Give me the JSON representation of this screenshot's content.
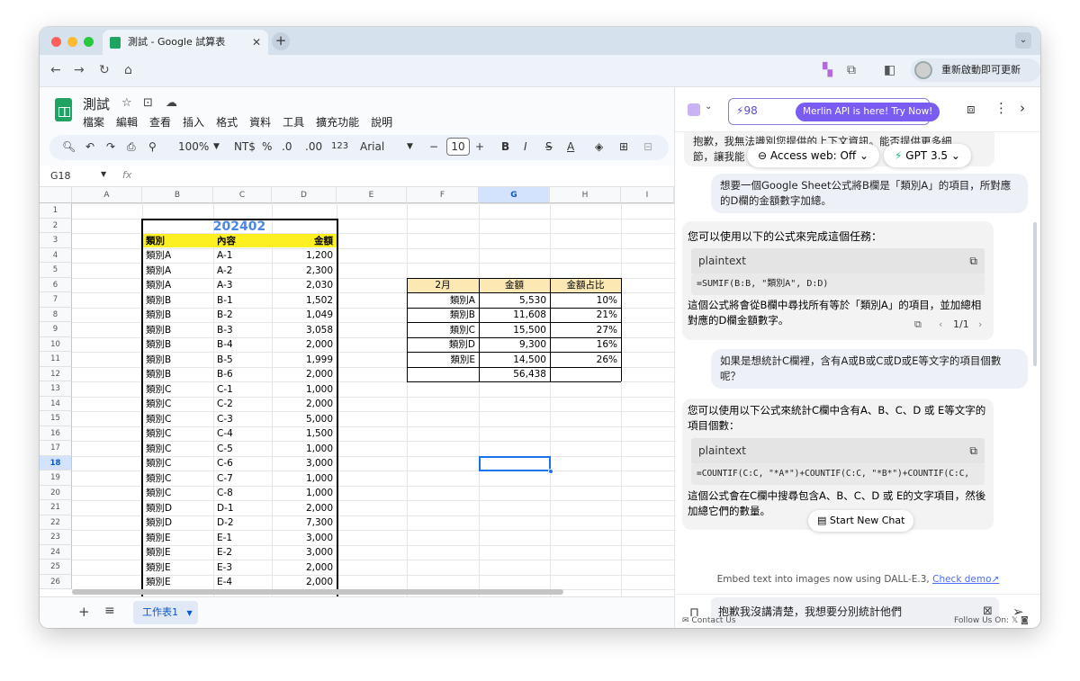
{
  "browser": {
    "tab_title": "測試 - Google 試算表",
    "update_label": "重新啟動即可更新"
  },
  "doc": {
    "title": "測試",
    "menus": [
      "檔案",
      "編輯",
      "查看",
      "插入",
      "格式",
      "資料",
      "工具",
      "擴充功能",
      "說明"
    ]
  },
  "toolbar": {
    "zoom": "100%",
    "currency": "NT$",
    "percent": "%",
    "dec_down": ".0",
    "dec_up": ".00",
    "num_format": "123",
    "font": "Arial",
    "font_size": "10"
  },
  "formula_bar": {
    "cell_ref": "G18",
    "fx": "fx"
  },
  "columns": [
    "A",
    "B",
    "C",
    "D",
    "E",
    "F",
    "G",
    "H",
    "I"
  ],
  "rows": [
    "1",
    "2",
    "3",
    "4",
    "5",
    "6",
    "7",
    "8",
    "9",
    "10",
    "11",
    "12",
    "13",
    "14",
    "15",
    "16",
    "17",
    "18",
    "19",
    "20",
    "21",
    "22",
    "23",
    "24",
    "25",
    "26"
  ],
  "table1": {
    "title": "202402",
    "headers": [
      "類別",
      "內容",
      "金額"
    ],
    "rows": [
      [
        "類別A",
        "A-1",
        "1,200"
      ],
      [
        "類別A",
        "A-2",
        "2,300"
      ],
      [
        "類別A",
        "A-3",
        "2,030"
      ],
      [
        "類別B",
        "B-1",
        "1,502"
      ],
      [
        "類別B",
        "B-2",
        "1,049"
      ],
      [
        "類別B",
        "B-3",
        "3,058"
      ],
      [
        "類別B",
        "B-4",
        "2,000"
      ],
      [
        "類別B",
        "B-5",
        "1,999"
      ],
      [
        "類別B",
        "B-6",
        "2,000"
      ],
      [
        "類別C",
        "C-1",
        "1,000"
      ],
      [
        "類別C",
        "C-2",
        "2,000"
      ],
      [
        "類別C",
        "C-3",
        "5,000"
      ],
      [
        "類別C",
        "C-4",
        "1,500"
      ],
      [
        "類別C",
        "C-5",
        "1,000"
      ],
      [
        "類別C",
        "C-6",
        "3,000"
      ],
      [
        "類別C",
        "C-7",
        "1,000"
      ],
      [
        "類別C",
        "C-8",
        "1,000"
      ],
      [
        "類別D",
        "D-1",
        "2,000"
      ],
      [
        "類別D",
        "D-2",
        "7,300"
      ],
      [
        "類別E",
        "E-1",
        "3,000"
      ],
      [
        "類別E",
        "E-2",
        "3,000"
      ],
      [
        "類別E",
        "E-3",
        "2,000"
      ],
      [
        "類別E",
        "E-4",
        "2,000"
      ]
    ]
  },
  "table2": {
    "headers": [
      "2月",
      "金額",
      "金額占比"
    ],
    "rows": [
      [
        "類別A",
        "5,530",
        "10%"
      ],
      [
        "類別B",
        "11,608",
        "21%"
      ],
      [
        "類別C",
        "15,500",
        "27%"
      ],
      [
        "類別D",
        "9,300",
        "16%"
      ],
      [
        "類別E",
        "14,500",
        "26%"
      ],
      [
        "",
        "56,438",
        ""
      ]
    ]
  },
  "sheet_tab": "工作表1",
  "merlin": {
    "count": "98",
    "banner": "Merlin API is here! Try Now!",
    "access_web": "Access web: Off",
    "model": "GPT 3.5",
    "top_fragment_1": "抱歉，我無法識別您提供的上下文資訊。能否提供更多細",
    "top_fragment_2": "節，讓我能",
    "user_msg_1": "想要一個Google Sheet公式將B欄是「類別A」的項目，所對應的D欄的金額數字加總。",
    "bot_msg_1_intro": "您可以使用以下的公式來完成這個任務：",
    "code_lang_1": "plaintext",
    "code_1": "=SUMIF(B:B, \"類別A\", D:D)",
    "bot_msg_1_outro": "這個公式將會從B欄中尋找所有等於「類別A」的項目，並加總相對應的D欄金額數字。",
    "pager": "1/1",
    "user_msg_2": "如果是想統計C欄裡，含有A或B或C或D或E等文字的項目個數呢？",
    "bot_msg_2_intro": "您可以使用以下公式來統計C欄中含有A、B、C、D 或 E等文字的項目個數：",
    "code_lang_2": "plaintext",
    "code_2": "=COUNTIF(C:C, \"*A*\")+COUNTIF(C:C, \"*B*\")+COUNTIF(C:C,",
    "bot_msg_2_outro": "這個公式會在C欄中搜尋包含A、B、C、D 或 E的文字項目，然後加總它們的數量。",
    "start_new_chat": "Start New Chat",
    "embed_note": "Embed text into images now using DALL-E.3,",
    "check_demo": "Check demo↗",
    "input_value": "抱歉我沒講清楚，我想要分別統計他們",
    "contact": "Contact Us",
    "follow": "Follow Us On:"
  }
}
